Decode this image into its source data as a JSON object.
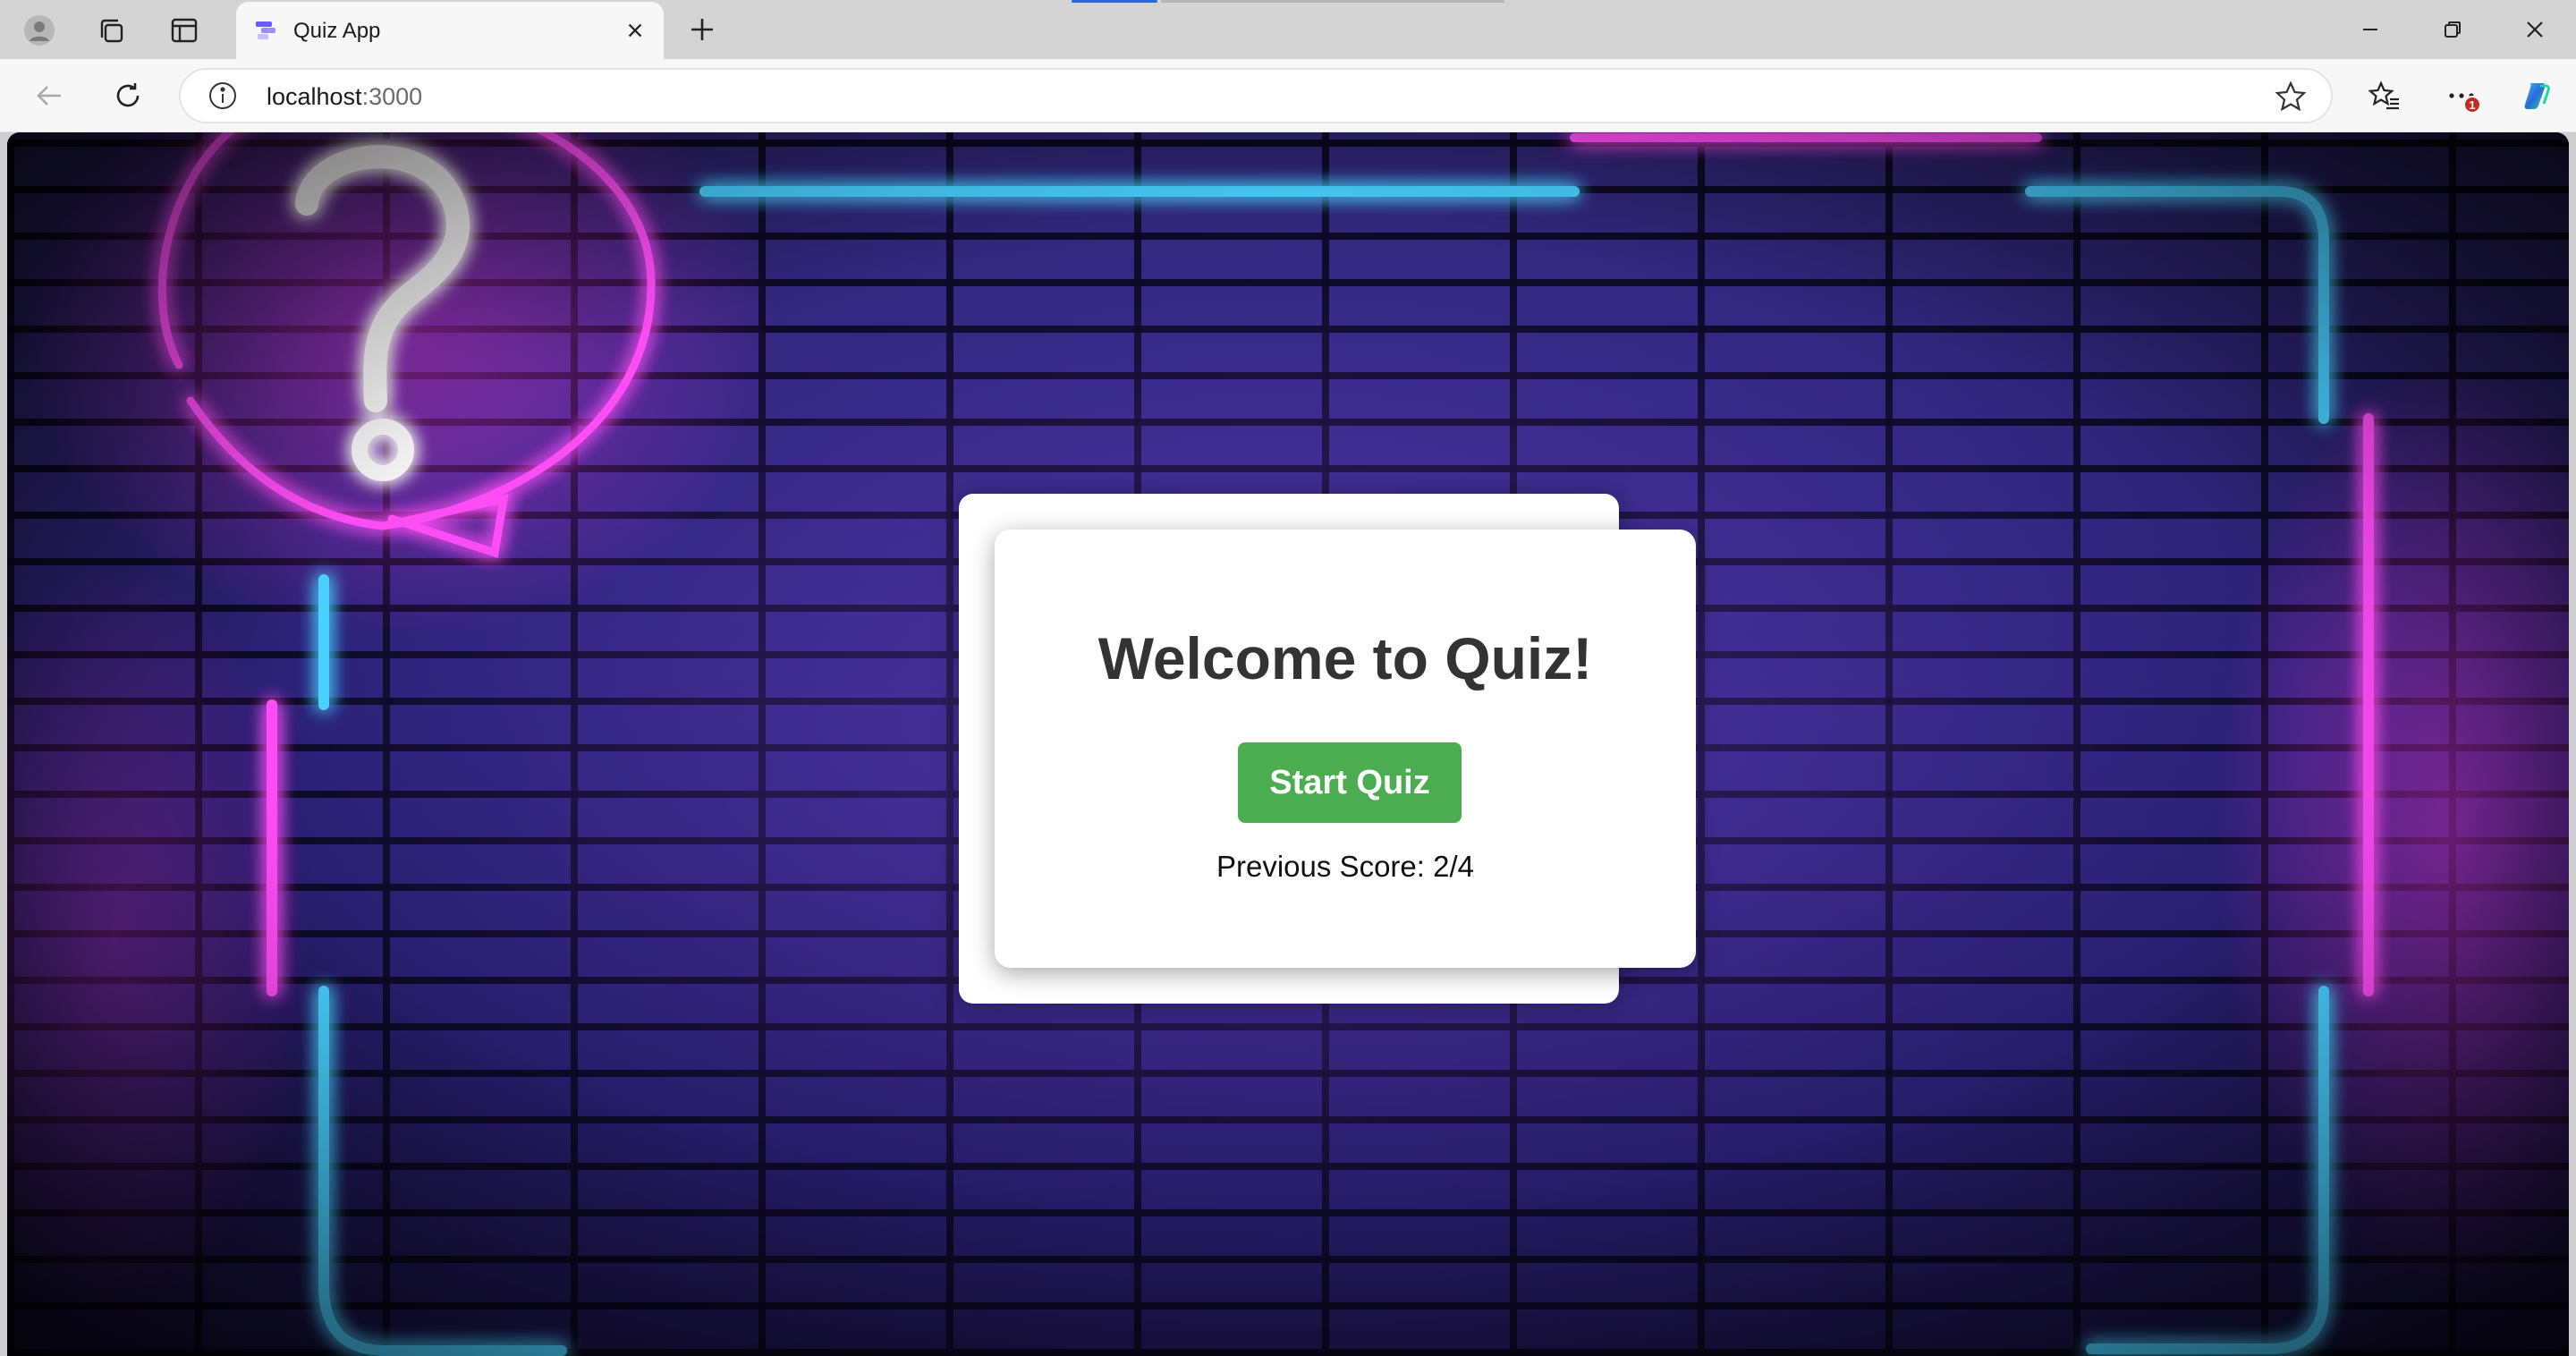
{
  "browser": {
    "tab": {
      "title": "Quiz App",
      "favicon": "quiz-app-favicon"
    },
    "address": {
      "host": "localhost",
      "port": ":3000"
    },
    "notification_badge": "1",
    "icons": [
      "profile-icon",
      "workspaces-icon",
      "tab-actions-icon",
      "close-icon",
      "plus-icon",
      "minimize-icon",
      "restore-icon",
      "back-icon",
      "refresh-icon",
      "info-icon",
      "favorite-star-icon",
      "favorites-icon",
      "more-icon",
      "copilot-icon"
    ]
  },
  "page": {
    "title": "Welcome to Quiz!",
    "start_button": "Start Quiz",
    "previous_score": "Previous Score: 2/4"
  },
  "colors": {
    "start_button": "#4cad50",
    "neon_pink": "#ff3df5",
    "neon_blue": "#38c8ff",
    "brick": "#2c2377"
  }
}
